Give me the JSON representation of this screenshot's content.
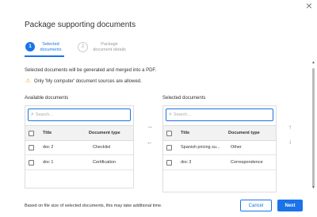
{
  "dialog": {
    "title": "Package supporting documents",
    "close_glyph": "×"
  },
  "stepper": {
    "steps": [
      {
        "number": "1",
        "line1": "Selected",
        "line2": "documents"
      },
      {
        "number": "2",
        "line1": "Package",
        "line2": "document details"
      }
    ]
  },
  "info_text": "Selected documents will be generated and merged into a PDF.",
  "warning_text": "Only 'My computer' document sources are allowed.",
  "available": {
    "label": "Available documents",
    "search_placeholder": "Search...",
    "columns": [
      "Title",
      "Document type"
    ],
    "rows": [
      {
        "title": "doc 2",
        "type": "Checklist"
      },
      {
        "title": "doc 1",
        "type": "Certification"
      }
    ]
  },
  "selected": {
    "label": "Selected documents",
    "search_placeholder": "Search...",
    "columns": [
      "Title",
      "Document type"
    ],
    "rows": [
      {
        "title": "Spanish pricing su...",
        "type": "Other"
      },
      {
        "title": "doc 3",
        "type": "Correspondence"
      }
    ]
  },
  "footer": {
    "note": "Based on file size of selected documents, this may take additional time.",
    "cancel_label": "Cancel",
    "next_label": "Next"
  },
  "icons": {
    "move_right": "→",
    "move_left": "←",
    "move_up": "↑",
    "move_down": "↓",
    "search": "⌕",
    "warning": "⚠",
    "scroll_up": "▲",
    "scroll_down": "▼"
  },
  "colors": {
    "accent": "#1a73e8",
    "warning": "#f0a500"
  }
}
